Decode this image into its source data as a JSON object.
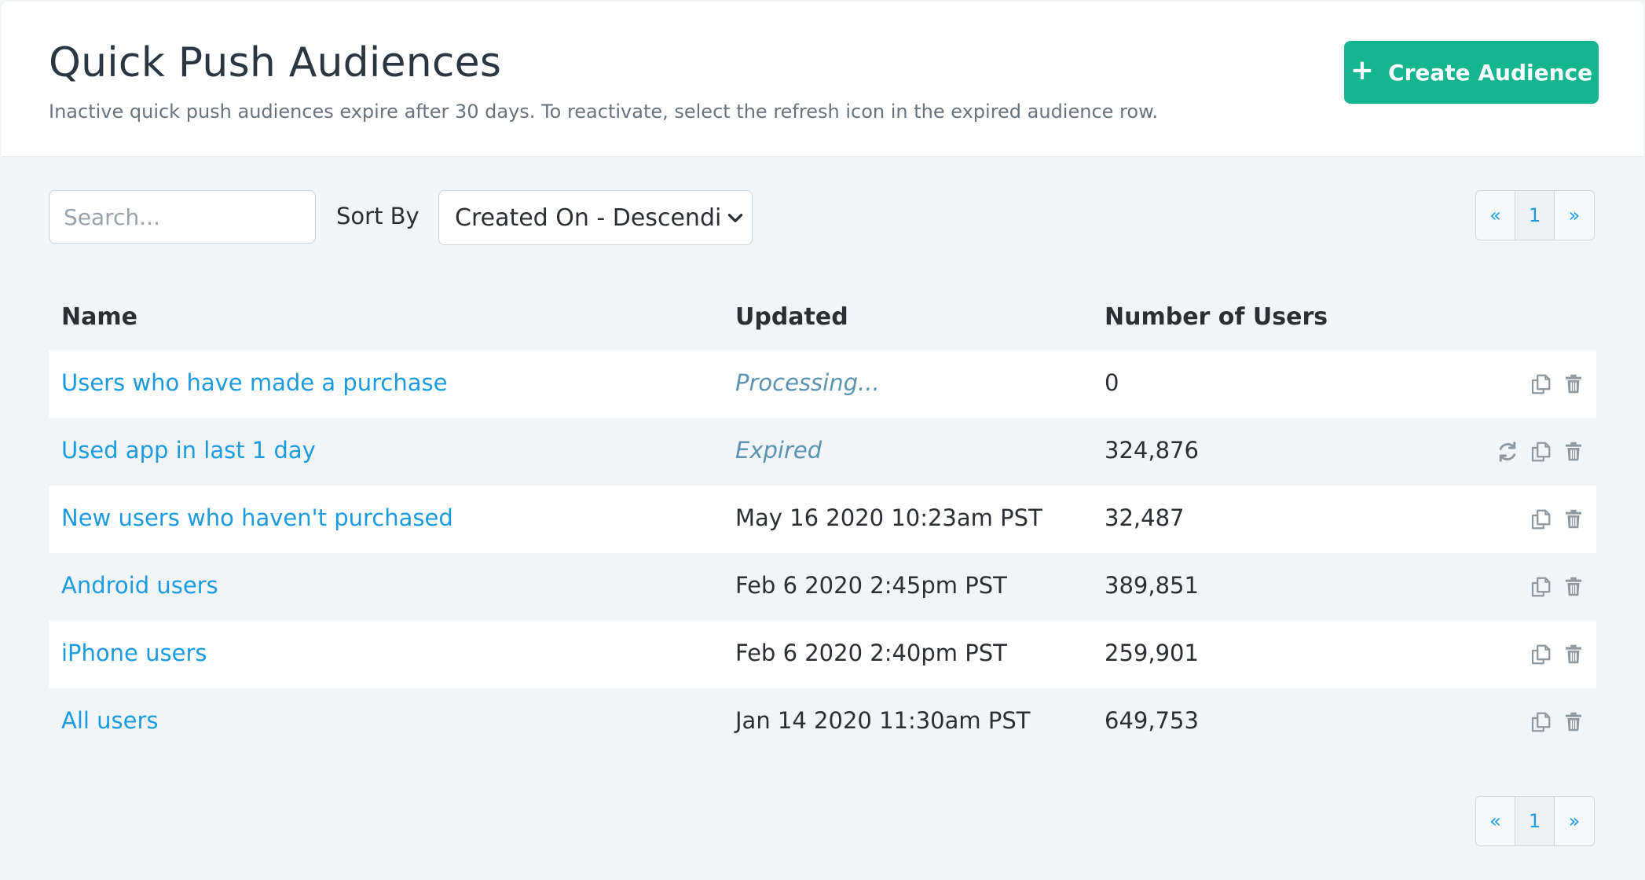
{
  "header": {
    "title": "Quick Push Audiences",
    "subtitle": "Inactive quick push audiences expire after 30 days. To reactivate, select the refresh icon in the expired audience row.",
    "create_button_label": "Create Audience",
    "create_button_icon": "plus-icon",
    "accent_color": "#14b58f"
  },
  "controls": {
    "search_placeholder": "Search...",
    "search_value": "",
    "sort_label": "Sort By",
    "sort_selected": "Created On - Descending"
  },
  "pagination": {
    "prev_label": "«",
    "current_page": "1",
    "next_label": "»"
  },
  "table": {
    "columns": [
      "Name",
      "Updated",
      "Number of Users"
    ],
    "rows": [
      {
        "name": "Users who have made a purchase",
        "updated": "Processing...",
        "users": "0",
        "status": true,
        "refresh": false
      },
      {
        "name": "Used app in last 1 day",
        "updated": "Expired",
        "users": "324,876",
        "status": true,
        "refresh": true
      },
      {
        "name": "New users who haven't purchased",
        "updated": "May 16 2020 10:23am PST",
        "users": "32,487",
        "status": false,
        "refresh": false
      },
      {
        "name": "Android users",
        "updated": "Feb 6 2020 2:45pm PST",
        "users": "389,851",
        "status": false,
        "refresh": false
      },
      {
        "name": "iPhone users",
        "updated": "Feb 6 2020 2:40pm PST",
        "users": "259,901",
        "status": false,
        "refresh": false
      },
      {
        "name": "All users",
        "updated": "Jan 14 2020 11:30am PST",
        "users": "649,753",
        "status": false,
        "refresh": false
      }
    ],
    "row_action_icons": [
      "refresh-icon",
      "duplicate-icon",
      "trash-icon"
    ],
    "link_color": "#1a9be0"
  }
}
